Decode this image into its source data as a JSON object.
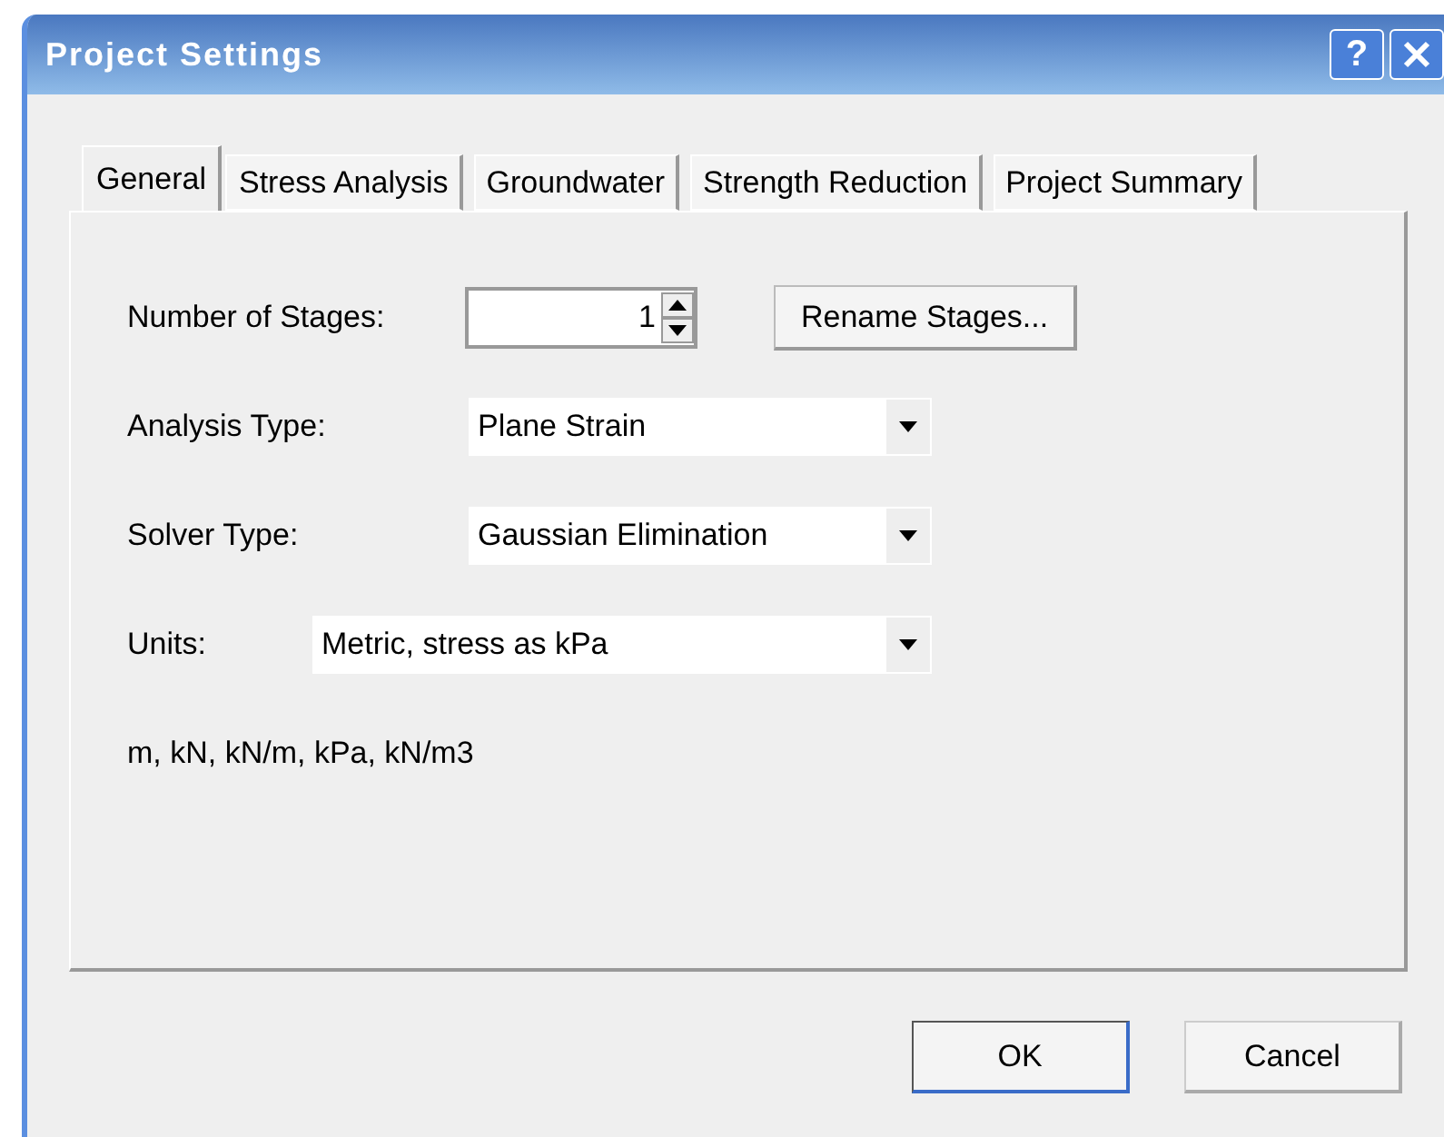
{
  "window": {
    "title": "Project Settings",
    "help_button": "?"
  },
  "tabs": [
    {
      "label": "General",
      "selected": true
    },
    {
      "label": "Stress Analysis",
      "selected": false
    },
    {
      "label": "Groundwater",
      "selected": false
    },
    {
      "label": "Strength Reduction",
      "selected": false
    },
    {
      "label": "Project Summary",
      "selected": false
    }
  ],
  "number_of_stages": {
    "label": "Number of Stages:",
    "value": "1"
  },
  "rename_button": "Rename Stages...",
  "dropdowns": [
    {
      "label": "Analysis Type:",
      "value": "Plane Strain",
      "kind": "wide"
    },
    {
      "label": "Solver Type:",
      "value": "Gaussian Elimination",
      "kind": "wide"
    },
    {
      "label": "Units:",
      "value": "Metric, stress as kPa",
      "kind": "long"
    }
  ],
  "units_summary": "m, kN, kN/m, kPa, kN/m3",
  "buttons": [
    {
      "label": "OK",
      "kind": "default"
    },
    {
      "label": "Cancel",
      "kind": "normal"
    }
  ]
}
